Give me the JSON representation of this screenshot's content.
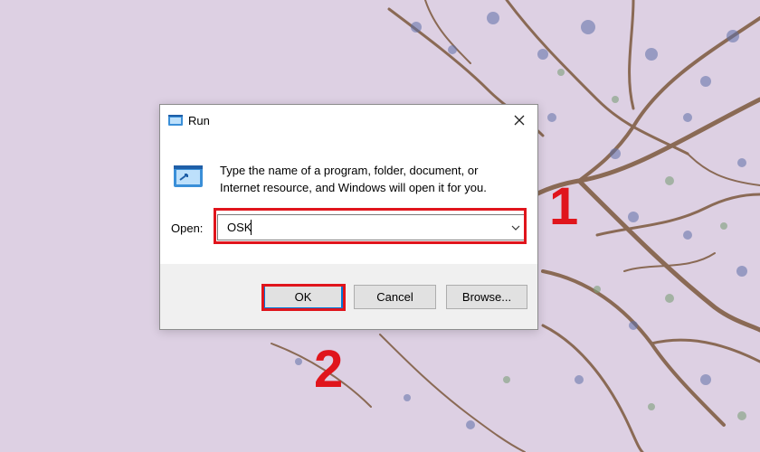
{
  "dialog": {
    "title": "Run",
    "description_line1": "Type the name of a program, folder, document, or",
    "description_line2": "Internet resource, and Windows will open it for you.",
    "open_label": "Open:",
    "open_value": "OSK",
    "buttons": {
      "ok": "OK",
      "cancel": "Cancel",
      "browse": "Browse..."
    },
    "icons": {
      "title": "run-icon",
      "body": "run-icon",
      "close": "close-icon",
      "dropdown": "chevron-down-icon"
    }
  },
  "annotations": {
    "step1": "1",
    "step2": "2",
    "color": "#e0151c"
  },
  "colors": {
    "wallpaper": "#ddd0e3",
    "focus_border": "#0078d7",
    "footer": "#f0f0f0"
  }
}
